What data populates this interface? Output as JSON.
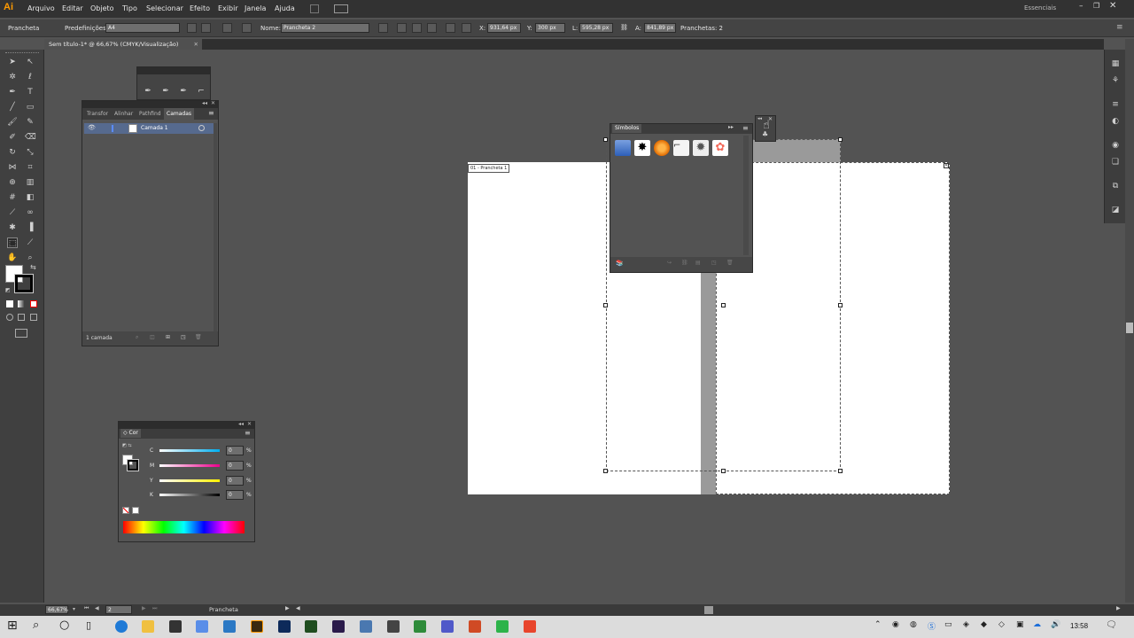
{
  "app": {
    "logo": "Ai"
  },
  "menu": [
    "Arquivo",
    "Editar",
    "Objeto",
    "Tipo",
    "Selecionar",
    "Efeito",
    "Exibir",
    "Janela",
    "Ajuda"
  ],
  "workspace": "Essenciais",
  "control_bar": {
    "tool_name": "Prancheta",
    "presets_label": "Predefinições:",
    "presets_value": "A4",
    "name_label": "Nome:",
    "name_value": "Prancheta 2",
    "x_label": "X:",
    "x_value": "931,64 px",
    "y_label": "Y:",
    "y_value": "300 px",
    "w_label": "L:",
    "w_value": "595,28 px",
    "h_label": "A:",
    "h_value": "841,89 px",
    "artboards_label": "Pranchetas: 2"
  },
  "document_tab": "Sem título-1* @ 66,67% (CMYK/Visualização)",
  "layers_panel": {
    "tabs": [
      "Transfor",
      "Alinhar",
      "Pathfind",
      "Camadas"
    ],
    "layer_name": "Camada 1",
    "footer": "1 camada"
  },
  "symbols_panel": {
    "title": "Símbolos"
  },
  "color_panel": {
    "title": "Cor",
    "channels": [
      {
        "label": "C",
        "value": "0",
        "unit": "%",
        "color": "#00aeef"
      },
      {
        "label": "M",
        "value": "0",
        "unit": "%",
        "color": "#ec008c"
      },
      {
        "label": "Y",
        "value": "0",
        "unit": "%",
        "color": "#fff200"
      },
      {
        "label": "K",
        "value": "0",
        "unit": "%",
        "color": "#000000"
      }
    ]
  },
  "artboard1_label": "01 - Prancheta 1",
  "status": {
    "zoom": "66,67%",
    "page": "2",
    "tool": "Prancheta"
  },
  "taskbar": {
    "time": "13:58"
  }
}
